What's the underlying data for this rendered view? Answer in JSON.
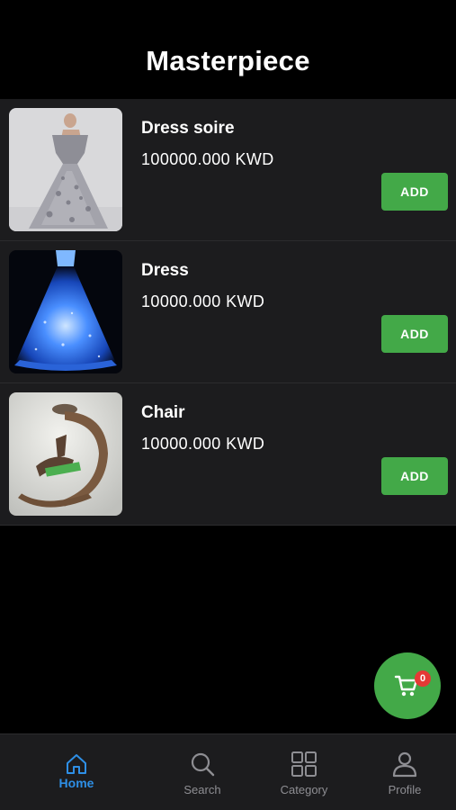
{
  "header": {
    "title": "Masterpiece"
  },
  "products": [
    {
      "name": "Dress soire",
      "price": "100000.000 KWD",
      "add_label": "ADD",
      "image": "silver-gown-photo"
    },
    {
      "name": "Dress",
      "price": "10000.000 KWD",
      "add_label": "ADD",
      "image": "blue-glowing-gown-photo"
    },
    {
      "name": "Chair",
      "price": "10000.000 KWD",
      "add_label": "ADD",
      "image": "designer-chair-photo"
    }
  ],
  "cart": {
    "count": "0",
    "icon": "cart-icon"
  },
  "tabs": [
    {
      "label": "Home",
      "icon": "home-icon",
      "active": true
    },
    {
      "label": "Search",
      "icon": "search-icon",
      "active": false
    },
    {
      "label": "Category",
      "icon": "grid-icon",
      "active": false
    },
    {
      "label": "Profile",
      "icon": "user-icon",
      "active": false
    }
  ],
  "colors": {
    "background": "#000000",
    "row_background": "#1c1c1e",
    "accent_green": "#43a948",
    "active_tab_blue": "#2e8fe6",
    "badge_red": "#e53935",
    "inactive_gray": "#8e8e93"
  }
}
